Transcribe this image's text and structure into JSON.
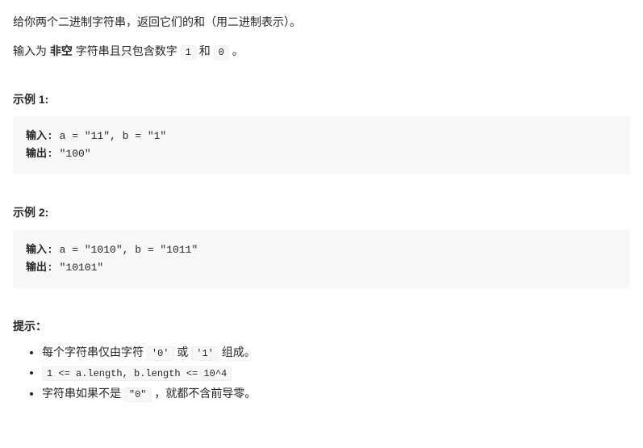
{
  "intro": {
    "line1": "给你两个二进制字符串，返回它们的和（用二进制表示）。",
    "line2_pre": "输入为 ",
    "line2_bold": "非空",
    "line2_mid": " 字符串且只包含数字 ",
    "const_1": "1",
    "line2_and": " 和 ",
    "const_0": "0",
    "line2_end": " 。"
  },
  "example1": {
    "heading": "示例 1:",
    "input_label": "输入:",
    "input_value": " a = \"11\", b = \"1\"",
    "output_label": "输出:",
    "output_value": " \"100\""
  },
  "example2": {
    "heading": "示例 2:",
    "input_label": "输入:",
    "input_value": " a = \"1010\", b = \"1011\"",
    "output_label": "输出:",
    "output_value": " \"10101\""
  },
  "hints": {
    "heading": "提示：",
    "item1_pre": "每个字符串仅由字符 ",
    "item1_c0": "'0'",
    "item1_mid": " 或 ",
    "item1_c1": "'1'",
    "item1_end": " 组成。",
    "item2_code": "1 <= a.length, b.length <= 10^4",
    "item3_pre": "字符串如果不是 ",
    "item3_c0": "\"0\"",
    "item3_end": " ，就都不含前导零。"
  }
}
